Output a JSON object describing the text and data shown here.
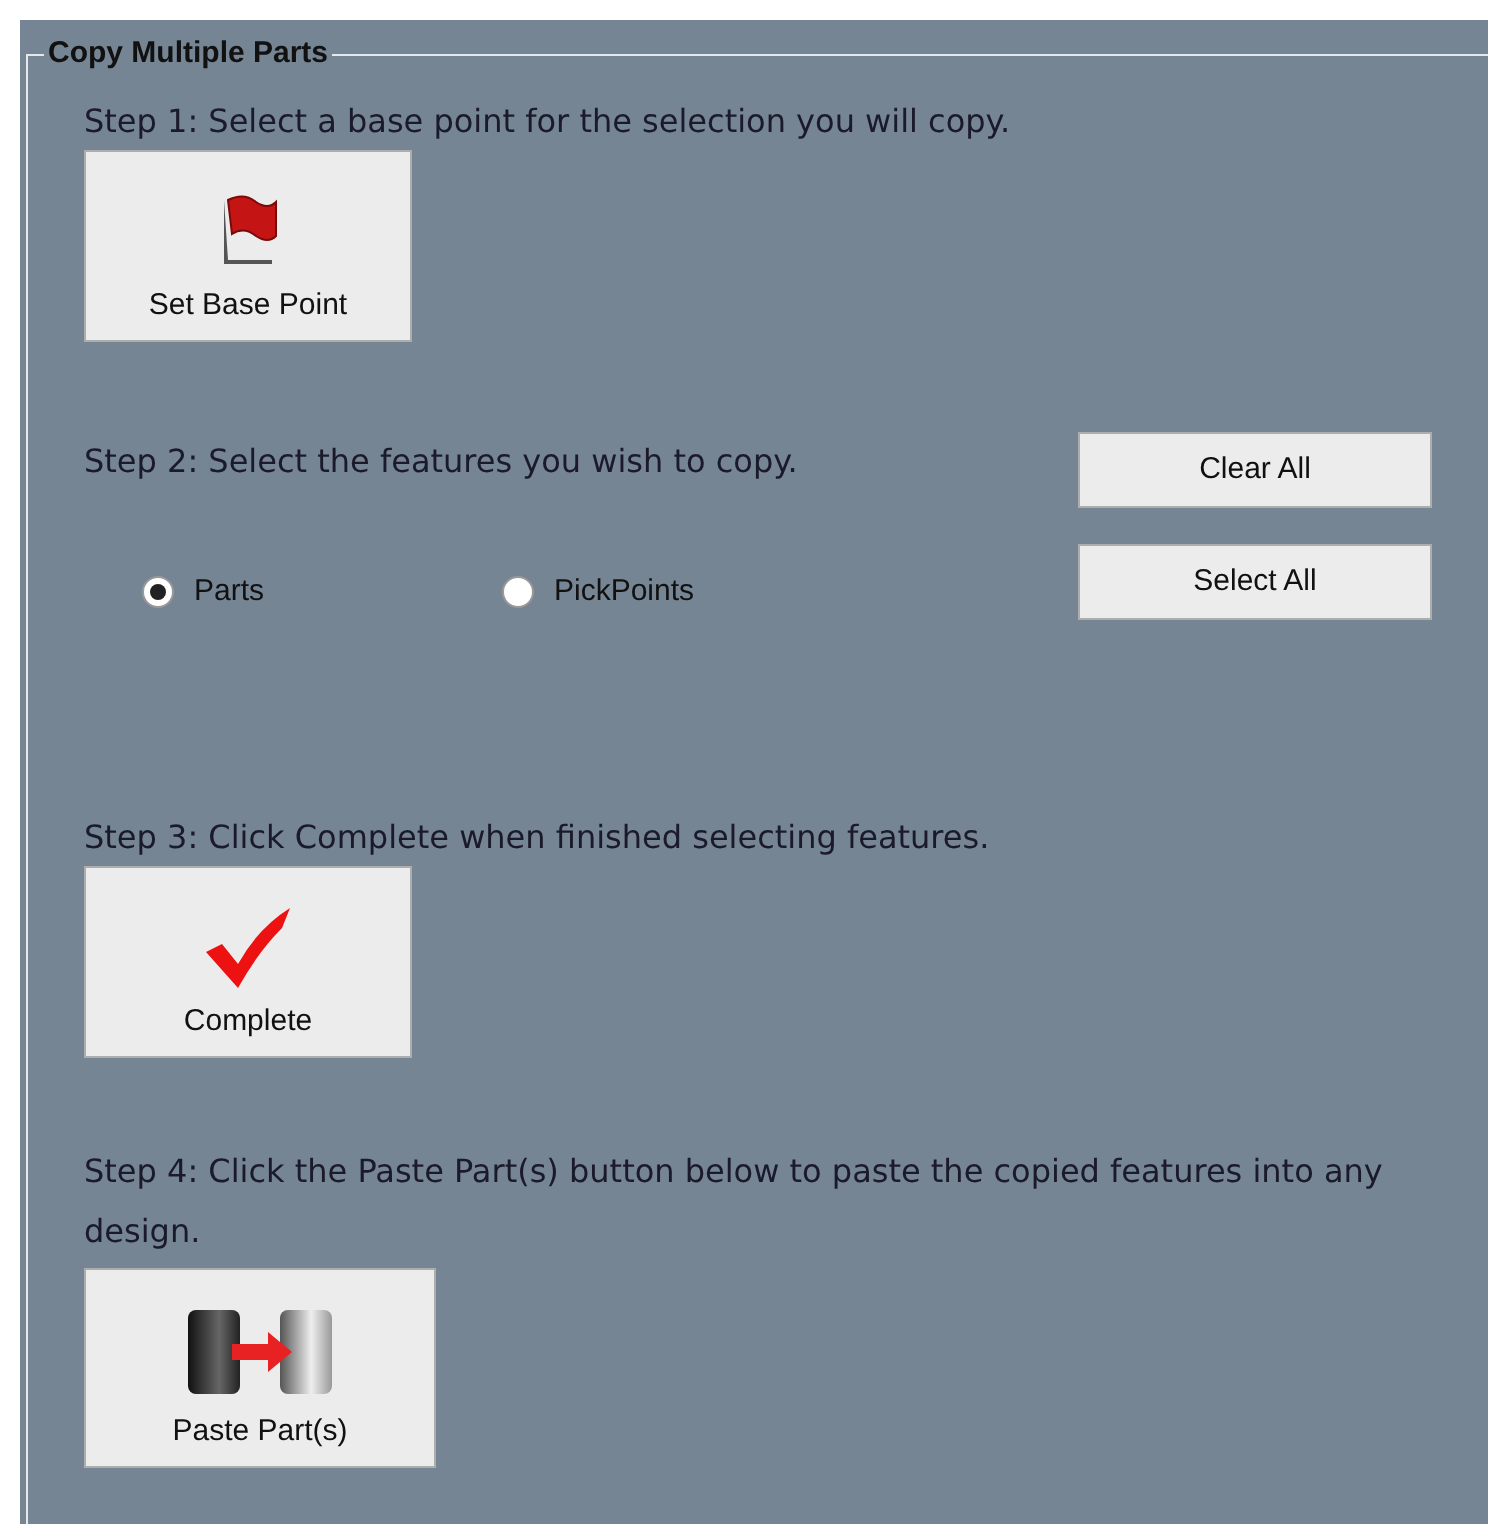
{
  "group": {
    "title": "Copy Multiple Parts"
  },
  "step1": {
    "text": "Step 1: Select a base point for the selection you will copy.",
    "button": "Set Base Point"
  },
  "step2": {
    "text": "Step 2: Select the features you wish to copy.",
    "buttons": [
      "Clear All",
      "Select All"
    ],
    "options": [
      {
        "label": "Parts",
        "selected": true
      },
      {
        "label": "PickPoints",
        "selected": false
      }
    ]
  },
  "step3": {
    "text": "Step 3: Click Complete when finished selecting features.",
    "button": "Complete"
  },
  "step4": {
    "text": "Step 4: Click the Paste Part(s) button below to paste the copied features into any design.",
    "button": "Paste Part(s)"
  }
}
